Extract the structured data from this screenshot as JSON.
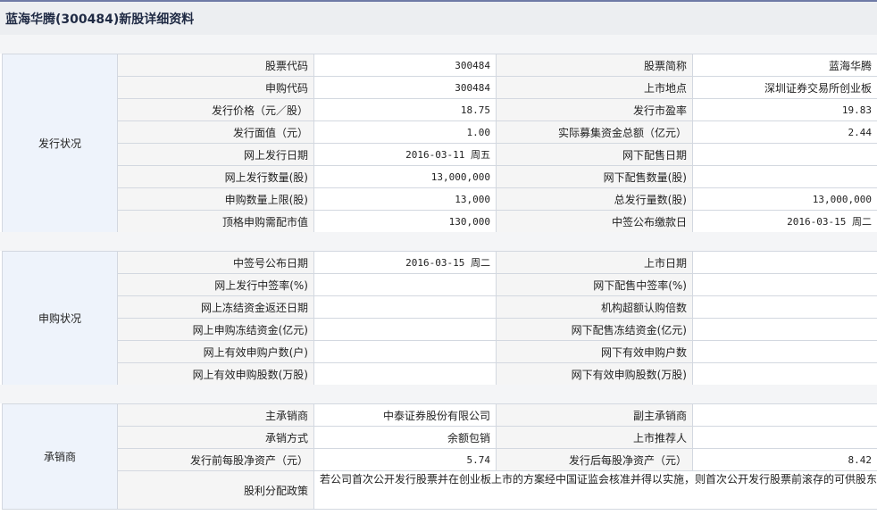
{
  "page_title": "蓝海华腾(300484)新股详细资料",
  "issue": {
    "group": "发行状况",
    "rows": [
      [
        "股票代码",
        "300484",
        "股票简称",
        "蓝海华腾"
      ],
      [
        "申购代码",
        "300484",
        "上市地点",
        "深圳证券交易所创业板"
      ],
      [
        "发行价格（元／股）",
        "18.75",
        "发行市盈率",
        "19.83"
      ],
      [
        "发行面值（元）",
        "1.00",
        "实际募集资金总额（亿元）",
        "2.44"
      ],
      [
        "网上发行日期",
        "2016-03-11 周五",
        "网下配售日期",
        ""
      ],
      [
        "网上发行数量(股)",
        "13,000,000",
        "网下配售数量(股)",
        ""
      ],
      [
        "申购数量上限(股)",
        "13,000",
        "总发行量数(股)",
        "13,000,000"
      ],
      [
        "顶格申购需配市值",
        "130,000",
        "中签公布缴款日",
        "2016-03-15 周二"
      ]
    ]
  },
  "subscription": {
    "group": "申购状况",
    "rows": [
      [
        "中签号公布日期",
        "2016-03-15 周二",
        "上市日期",
        ""
      ],
      [
        "网上发行中签率(%)",
        "",
        "网下配售中签率(%)",
        ""
      ],
      [
        "网上冻结资金返还日期",
        "",
        "机构超额认购倍数",
        ""
      ],
      [
        "网上申购冻结资金(亿元)",
        "",
        "网下配售冻结资金(亿元)",
        ""
      ],
      [
        "网上有效申购户数(户)",
        "",
        "网下有效申购户数",
        ""
      ],
      [
        "网上有效申购股数(万股)",
        "",
        "网下有效申购股数(万股)",
        ""
      ]
    ]
  },
  "underwriter": {
    "group": "承销商",
    "rows": [
      [
        "主承销商",
        "中泰证券股份有限公司",
        "副主承销商",
        ""
      ],
      [
        "承销方式",
        "余额包销",
        "上市推荐人",
        ""
      ],
      [
        "发行前每股净资产（元）",
        "5.74",
        "发行后每股净资产（元）",
        "8.42"
      ]
    ],
    "policy_label": "股利分配政策",
    "policy_text": "若公司首次公开发行股票并在创业板上市的方案经中国证监会核准并得以实施，则首次公开发行股票前滚存的可供股东分配的未分配利润在公司首次公开发行股票并在创业板上市后由公司新老股东按照持股比例共享。"
  }
}
